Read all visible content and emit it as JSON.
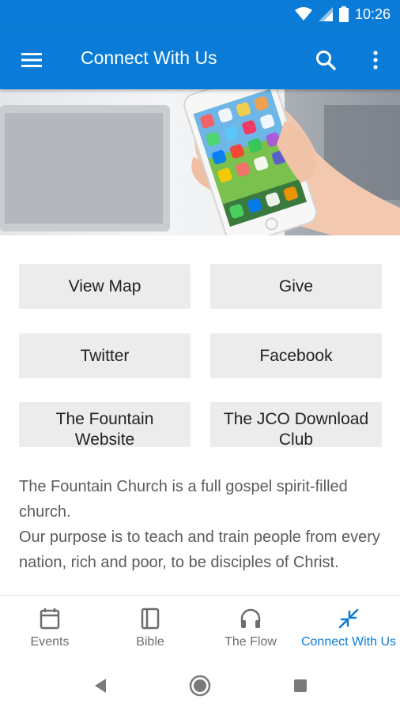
{
  "status_bar": {
    "time": "10:26"
  },
  "app_bar": {
    "title": "Connect With Us"
  },
  "buttons": {
    "view_map": "View Map",
    "give": "Give",
    "twitter": "Twitter",
    "facebook": "Facebook",
    "fountain_website": "The Fountain Website",
    "jco_download_club": "The JCO Download Club"
  },
  "description": {
    "line1": "The Fountain Church is a full gospel spirit-filled church.",
    "line2": "Our purpose is to teach and train people from every nation, rich and poor, to be disciples of Christ."
  },
  "bottom_nav": {
    "items": [
      {
        "label": "Events",
        "icon": "calendar-icon"
      },
      {
        "label": "Bible",
        "icon": "book-icon"
      },
      {
        "label": "The Flow",
        "icon": "headphones-icon"
      },
      {
        "label": "Connect With Us",
        "icon": "connect-arrows-icon"
      }
    ],
    "active": "Connect With Us"
  },
  "colors": {
    "primary": "#0a7bd6",
    "tile_bg": "#ececec",
    "text_body": "#5b5b5b",
    "nav_inactive": "#6d6d6d"
  }
}
